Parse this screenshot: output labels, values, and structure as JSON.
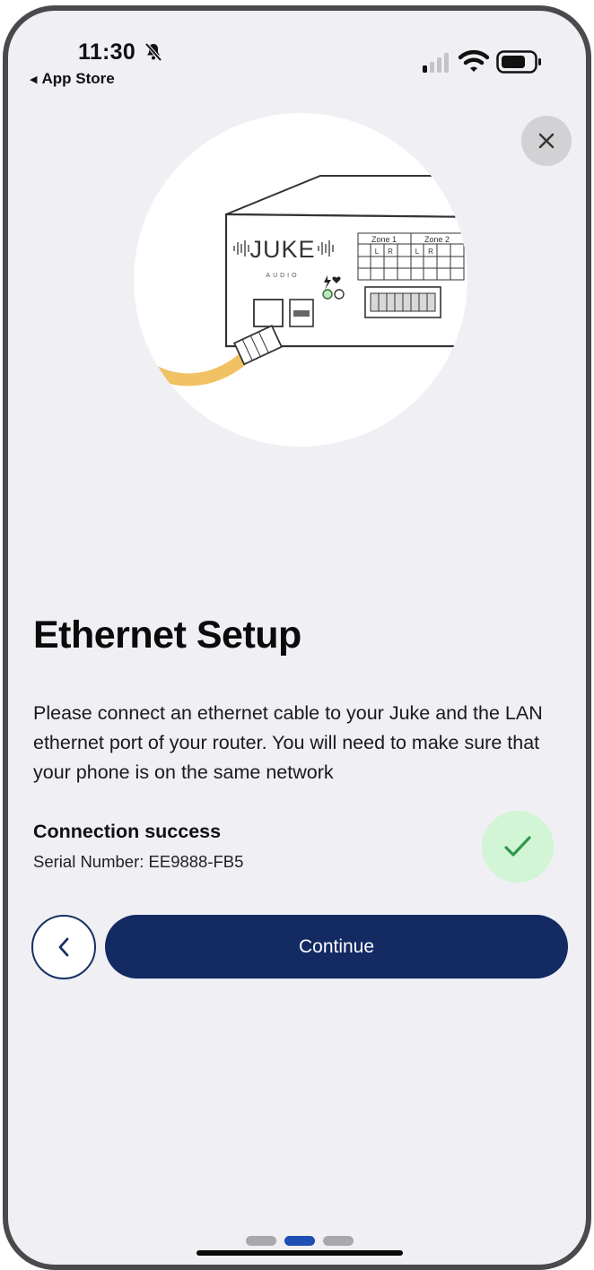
{
  "status_bar": {
    "time": "11:30",
    "back_app_label": "App Store",
    "icons": [
      "bell-slash-icon",
      "cellular-signal-icon",
      "wifi-icon",
      "battery-icon"
    ]
  },
  "close_icon": "close-icon",
  "hero": {
    "device_brand": "JUKE",
    "device_sub": "AUDIO",
    "zone_labels": [
      "Zone 1",
      "Zone 2"
    ],
    "channel_labels": [
      "L",
      "R",
      "L",
      "R"
    ],
    "cable_color": "#f1c264"
  },
  "main": {
    "title": "Ethernet Setup",
    "description": "Please connect an ethernet cable to your Juke and the LAN ethernet port of your router. You will need to make sure that your phone is on the same network",
    "connection_status": "Connection success",
    "serial_number": "Serial Number: EE9888-FB5"
  },
  "actions": {
    "continue_label": "Continue",
    "back_icon": "chevron-left-icon"
  },
  "pager": {
    "total": 3,
    "current": 2
  },
  "colors": {
    "primary": "#132a63",
    "success_bg": "#d2f5d5",
    "success_check": "#2e9a4c",
    "background": "#efeff4"
  }
}
